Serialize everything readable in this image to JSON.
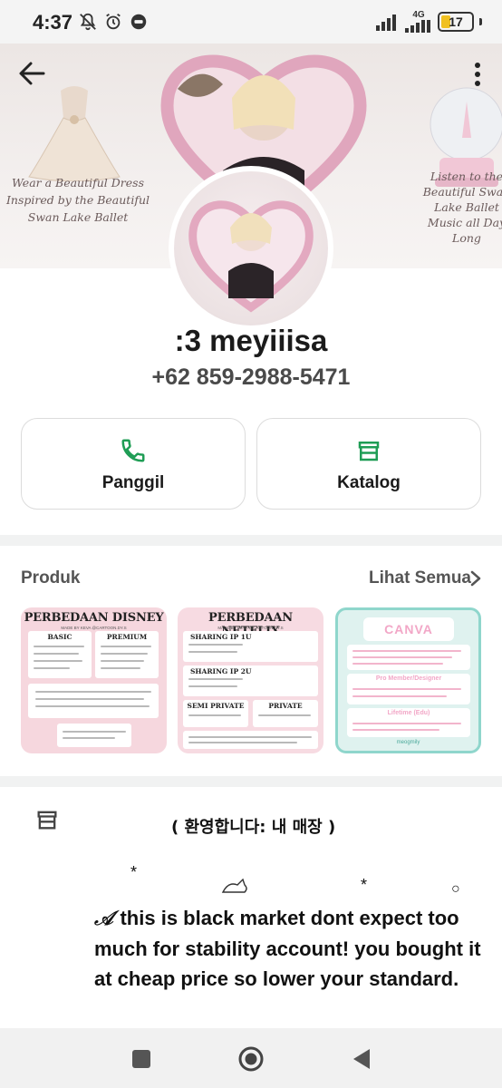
{
  "status_bar": {
    "time": "4:37",
    "network": "4G",
    "battery": "17"
  },
  "cover": {
    "left_text": "Wear a Beautiful Dress Inspired by the Beautiful Swan Lake Ballet",
    "right_text": "Listen to the Beautiful Swan Lake Ballet Music all Day Long"
  },
  "profile": {
    "name": ":3 meyiiisa",
    "phone": "+62 859-2988-5471"
  },
  "actions": {
    "call_label": "Panggil",
    "catalog_label": "Katalog"
  },
  "products": {
    "title": "Produk",
    "see_all": "Lihat Semua",
    "items": [
      {
        "heading": "PERBEDAAN DISNEY",
        "sub": "MADE BY KEVA @CARTOON.DY.S",
        "col1": "BASIC",
        "col2": "PREMIUM"
      },
      {
        "heading": "PERBEDAAN NETFLIX",
        "sub": "MADE BY KEVA @CARTOON.DY.S",
        "col1": "SHARING IP 1U",
        "col2": "SHARING IP 2U",
        "col3": "SEMI PRIVATE",
        "col4": "PRIVATE"
      },
      {
        "heading": "CANVA",
        "box1": "Pro Member/Designer",
        "box2": "Lifetime (Edu)",
        "footer": "meogmily"
      }
    ]
  },
  "bio": {
    "title": "( 환영합니다: 내 매장 )",
    "text": "this is black market dont expect too much for stability account! you bought it at cheap price so lower your standard."
  },
  "colors": {
    "accent_green": "#1f9d55",
    "product1_bg": "#f6d7de",
    "product3_border": "#8fd6cc"
  }
}
